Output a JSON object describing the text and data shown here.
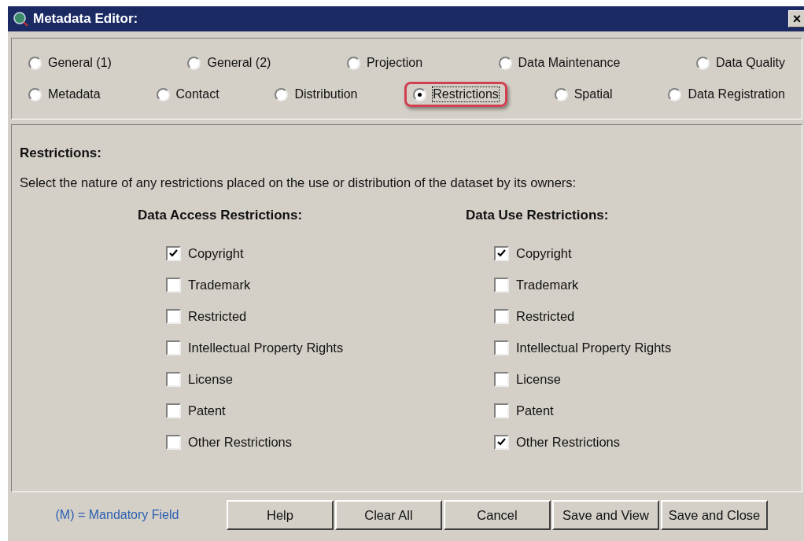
{
  "window": {
    "title": "Metadata Editor:",
    "close": "×"
  },
  "tabs": [
    [
      {
        "label": "General (1)",
        "selected": false
      },
      {
        "label": "General (2)",
        "selected": false
      },
      {
        "label": "Projection",
        "selected": false
      },
      {
        "label": "Data Maintenance",
        "selected": false
      },
      {
        "label": "Data Quality",
        "selected": false
      }
    ],
    [
      {
        "label": "Metadata",
        "selected": false
      },
      {
        "label": "Contact",
        "selected": false
      },
      {
        "label": "Distribution",
        "selected": false
      },
      {
        "label": "Restrictions",
        "selected": true
      },
      {
        "label": "Spatial",
        "selected": false
      },
      {
        "label": "Data Registration",
        "selected": false
      }
    ]
  ],
  "section": {
    "title": "Restrictions:",
    "description": "Select the nature of any restrictions placed on the use or distribution of the dataset by its owners:"
  },
  "groups": [
    {
      "title": "Data Access Restrictions:",
      "options": [
        {
          "label": "Copyright",
          "checked": true
        },
        {
          "label": "Trademark",
          "checked": false
        },
        {
          "label": "Restricted",
          "checked": false
        },
        {
          "label": "Intellectual Property Rights",
          "checked": false
        },
        {
          "label": "License",
          "checked": false
        },
        {
          "label": "Patent",
          "checked": false
        },
        {
          "label": "Other Restrictions",
          "checked": false
        }
      ]
    },
    {
      "title": "Data Use Restrictions:",
      "options": [
        {
          "label": "Copyright",
          "checked": true
        },
        {
          "label": "Trademark",
          "checked": false
        },
        {
          "label": "Restricted",
          "checked": false
        },
        {
          "label": "Intellectual Property Rights",
          "checked": false
        },
        {
          "label": "License",
          "checked": false
        },
        {
          "label": "Patent",
          "checked": false
        },
        {
          "label": "Other Restrictions",
          "checked": true
        }
      ]
    }
  ],
  "footer": {
    "note": "(M) = Mandatory Field",
    "buttons": [
      "Help",
      "Clear All",
      "Cancel",
      "Save and View",
      "Save and Close"
    ]
  }
}
